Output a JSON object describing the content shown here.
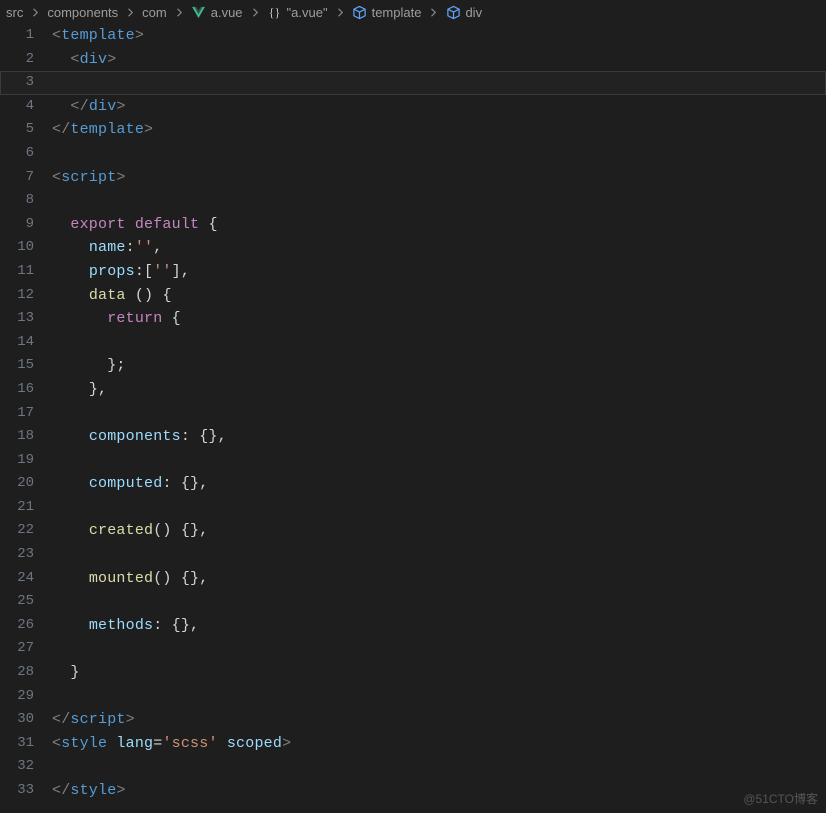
{
  "breadcrumb": {
    "items": [
      {
        "label": "src",
        "icon": null
      },
      {
        "label": "components",
        "icon": null
      },
      {
        "label": "com",
        "icon": null
      },
      {
        "label": "a.vue",
        "icon": "vue"
      },
      {
        "label": "\"a.vue\"",
        "icon": "braces"
      },
      {
        "label": "template",
        "icon": "cube"
      },
      {
        "label": "div",
        "icon": "cube"
      }
    ],
    "separator": "›"
  },
  "editor": {
    "current_line": 3,
    "lines": [
      {
        "n": 1,
        "tokens": [
          {
            "c": "t-punct",
            "t": "<"
          },
          {
            "c": "t-tag",
            "t": "template"
          },
          {
            "c": "t-punct",
            "t": ">"
          }
        ]
      },
      {
        "n": 2,
        "indent": 2,
        "tokens": [
          {
            "c": "t-punct",
            "t": "<"
          },
          {
            "c": "t-tag",
            "t": "div"
          },
          {
            "c": "t-punct",
            "t": ">"
          }
        ]
      },
      {
        "n": 3,
        "tokens": []
      },
      {
        "n": 4,
        "indent": 2,
        "tokens": [
          {
            "c": "t-punct",
            "t": "</"
          },
          {
            "c": "t-tag",
            "t": "div"
          },
          {
            "c": "t-punct",
            "t": ">"
          }
        ]
      },
      {
        "n": 5,
        "tokens": [
          {
            "c": "t-punct",
            "t": "</"
          },
          {
            "c": "t-tag",
            "t": "template"
          },
          {
            "c": "t-punct",
            "t": ">"
          }
        ]
      },
      {
        "n": 6,
        "tokens": []
      },
      {
        "n": 7,
        "tokens": [
          {
            "c": "t-punct",
            "t": "<"
          },
          {
            "c": "t-tag",
            "t": "script"
          },
          {
            "c": "t-punct",
            "t": ">"
          }
        ]
      },
      {
        "n": 8,
        "tokens": []
      },
      {
        "n": 9,
        "indent": 2,
        "tokens": [
          {
            "c": "t-keyword",
            "t": "export"
          },
          {
            "c": "t-plain",
            "t": " "
          },
          {
            "c": "t-keyword",
            "t": "default"
          },
          {
            "c": "t-plain",
            "t": " "
          },
          {
            "c": "t-brace",
            "t": "{"
          }
        ]
      },
      {
        "n": 10,
        "indent": 4,
        "tokens": [
          {
            "c": "t-prop",
            "t": "name"
          },
          {
            "c": "t-plain",
            "t": ":"
          },
          {
            "c": "t-string",
            "t": "''"
          },
          {
            "c": "t-plain",
            "t": ","
          }
        ]
      },
      {
        "n": 11,
        "indent": 4,
        "tokens": [
          {
            "c": "t-prop",
            "t": "props"
          },
          {
            "c": "t-plain",
            "t": ":["
          },
          {
            "c": "t-string",
            "t": "''"
          },
          {
            "c": "t-plain",
            "t": "],"
          }
        ]
      },
      {
        "n": 12,
        "indent": 4,
        "tokens": [
          {
            "c": "t-func",
            "t": "data"
          },
          {
            "c": "t-plain",
            "t": " () "
          },
          {
            "c": "t-brace",
            "t": "{"
          }
        ]
      },
      {
        "n": 13,
        "indent": 6,
        "tokens": [
          {
            "c": "t-keyword",
            "t": "return"
          },
          {
            "c": "t-plain",
            "t": " "
          },
          {
            "c": "t-brace",
            "t": "{"
          }
        ]
      },
      {
        "n": 14,
        "tokens": []
      },
      {
        "n": 15,
        "indent": 6,
        "tokens": [
          {
            "c": "t-brace",
            "t": "}"
          },
          {
            "c": "t-plain",
            "t": ";"
          }
        ]
      },
      {
        "n": 16,
        "indent": 4,
        "tokens": [
          {
            "c": "t-brace",
            "t": "}"
          },
          {
            "c": "t-plain",
            "t": ","
          }
        ]
      },
      {
        "n": 17,
        "tokens": []
      },
      {
        "n": 18,
        "indent": 4,
        "tokens": [
          {
            "c": "t-prop",
            "t": "components"
          },
          {
            "c": "t-plain",
            "t": ": "
          },
          {
            "c": "t-brace",
            "t": "{}"
          },
          {
            "c": "t-plain",
            "t": ","
          }
        ]
      },
      {
        "n": 19,
        "tokens": []
      },
      {
        "n": 20,
        "indent": 4,
        "tokens": [
          {
            "c": "t-prop",
            "t": "computed"
          },
          {
            "c": "t-plain",
            "t": ": "
          },
          {
            "c": "t-brace",
            "t": "{}"
          },
          {
            "c": "t-plain",
            "t": ","
          }
        ]
      },
      {
        "n": 21,
        "tokens": []
      },
      {
        "n": 22,
        "indent": 4,
        "tokens": [
          {
            "c": "t-func",
            "t": "created"
          },
          {
            "c": "t-plain",
            "t": "() "
          },
          {
            "c": "t-brace",
            "t": "{}"
          },
          {
            "c": "t-plain",
            "t": ","
          }
        ]
      },
      {
        "n": 23,
        "tokens": []
      },
      {
        "n": 24,
        "indent": 4,
        "tokens": [
          {
            "c": "t-func",
            "t": "mounted"
          },
          {
            "c": "t-plain",
            "t": "() "
          },
          {
            "c": "t-brace",
            "t": "{}"
          },
          {
            "c": "t-plain",
            "t": ","
          }
        ]
      },
      {
        "n": 25,
        "tokens": []
      },
      {
        "n": 26,
        "indent": 4,
        "tokens": [
          {
            "c": "t-prop",
            "t": "methods"
          },
          {
            "c": "t-plain",
            "t": ": "
          },
          {
            "c": "t-brace",
            "t": "{}"
          },
          {
            "c": "t-plain",
            "t": ","
          }
        ]
      },
      {
        "n": 27,
        "tokens": []
      },
      {
        "n": 28,
        "indent": 2,
        "tokens": [
          {
            "c": "t-brace",
            "t": "}"
          }
        ]
      },
      {
        "n": 29,
        "tokens": []
      },
      {
        "n": 30,
        "tokens": [
          {
            "c": "t-punct",
            "t": "</"
          },
          {
            "c": "t-tag",
            "t": "script"
          },
          {
            "c": "t-punct",
            "t": ">"
          }
        ]
      },
      {
        "n": 31,
        "tokens": [
          {
            "c": "t-punct",
            "t": "<"
          },
          {
            "c": "t-tag",
            "t": "style"
          },
          {
            "c": "t-plain",
            "t": " "
          },
          {
            "c": "t-attr",
            "t": "lang"
          },
          {
            "c": "t-plain",
            "t": "="
          },
          {
            "c": "t-string",
            "t": "'scss'"
          },
          {
            "c": "t-plain",
            "t": " "
          },
          {
            "c": "t-attr",
            "t": "scoped"
          },
          {
            "c": "t-punct",
            "t": ">"
          }
        ]
      },
      {
        "n": 32,
        "tokens": []
      },
      {
        "n": 33,
        "tokens": [
          {
            "c": "t-punct",
            "t": "</"
          },
          {
            "c": "t-tag",
            "t": "style"
          },
          {
            "c": "t-punct",
            "t": ">"
          }
        ]
      }
    ]
  },
  "watermark": "@51CTO博客"
}
